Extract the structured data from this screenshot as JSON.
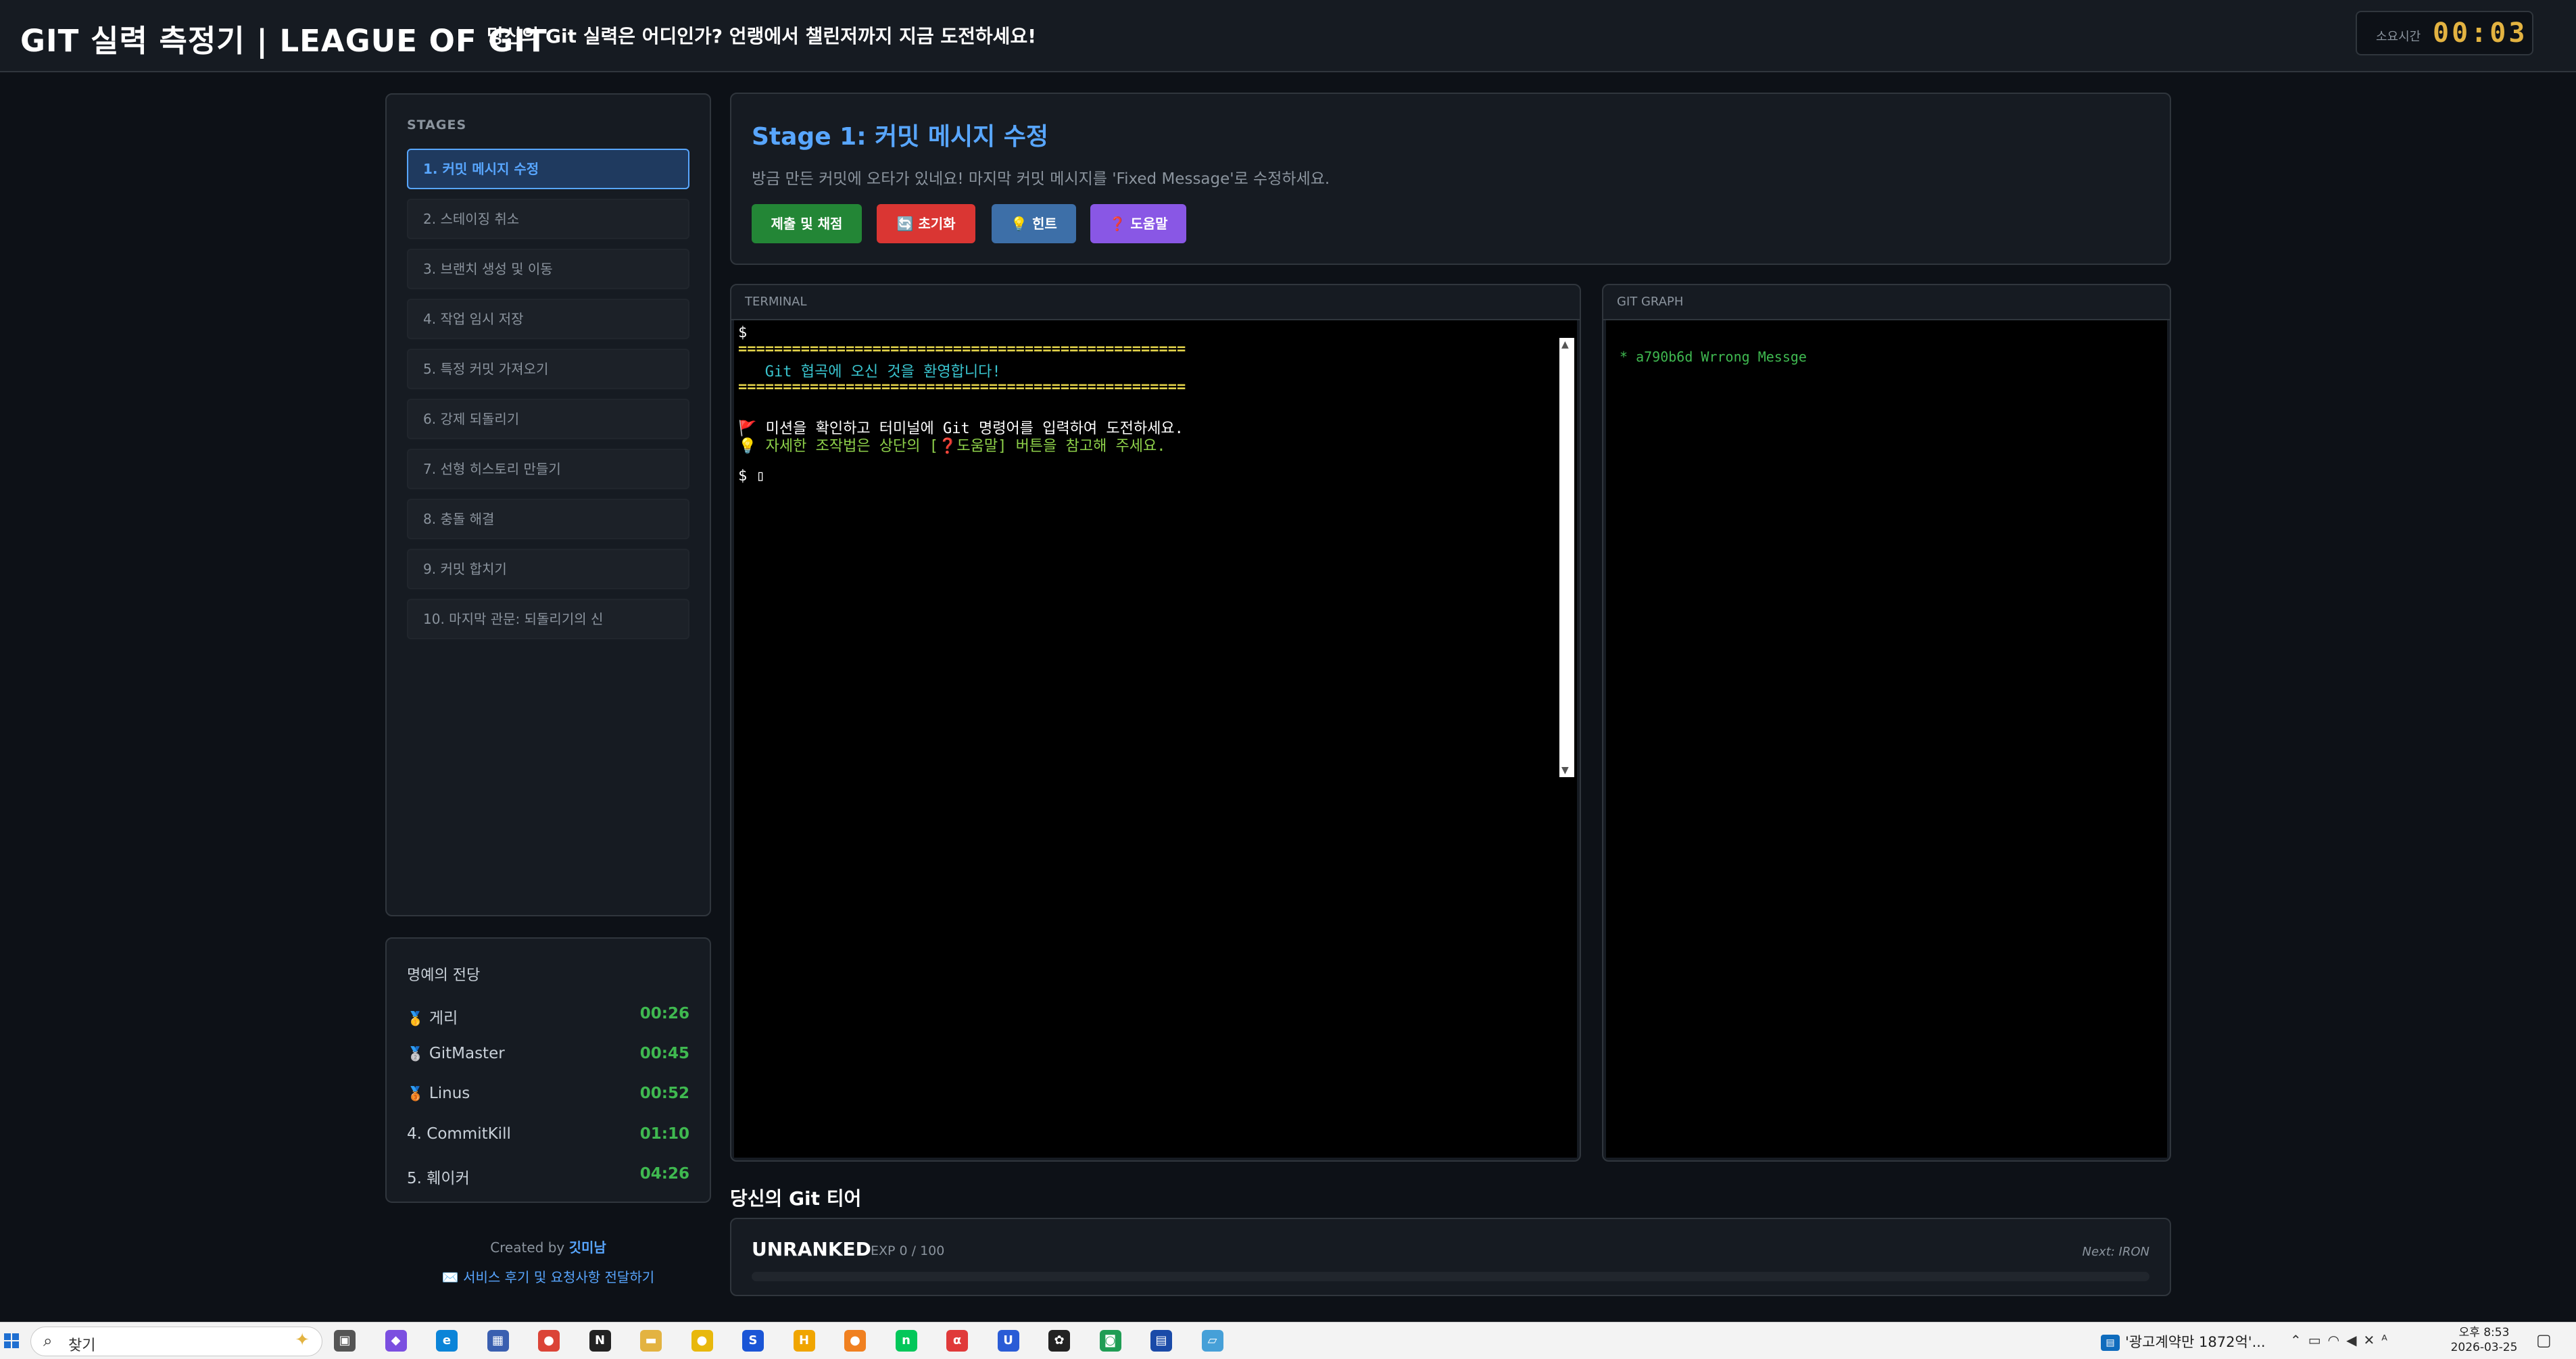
{
  "header": {
    "title": "GIT 실력 측정기 | LEAGUE OF GIT",
    "tagline": "당신의 Git 실력은 어디인가? 언랭에서 챌린저까지 지금 도전하세요!",
    "timer_label": "소요시간",
    "timer_value": "00:03"
  },
  "stages": {
    "title": "STAGES",
    "items": [
      {
        "label": "1. 커밋 메시지 수정",
        "active": true
      },
      {
        "label": "2. 스테이징 취소"
      },
      {
        "label": "3. 브랜치 생성 및 이동"
      },
      {
        "label": "4. 작업 임시 저장"
      },
      {
        "label": "5. 특정 커밋 가져오기"
      },
      {
        "label": "6. 강제 되돌리기"
      },
      {
        "label": "7. 선형 히스토리 만들기"
      },
      {
        "label": "8. 충돌 해결"
      },
      {
        "label": "9. 커밋 합치기"
      },
      {
        "label": "10. 마지막 관문: 되돌리기의 신"
      }
    ]
  },
  "hall_of_fame": {
    "title": "명예의 전당",
    "entries": [
      {
        "medal": "🥇",
        "name": "게리",
        "time": "00:26"
      },
      {
        "medal": "🥈",
        "name": "GitMaster",
        "time": "00:45"
      },
      {
        "medal": "🥉",
        "name": "Linus",
        "time": "00:52"
      },
      {
        "medal": "",
        "name": "4. CommitKill",
        "time": "01:10"
      },
      {
        "medal": "",
        "name": "5. 훼이커",
        "time": "04:26"
      }
    ]
  },
  "credit": {
    "prefix": "Created by",
    "author": "깃미남",
    "feedback": "✉️ 서비스 후기 및 요청사항 전달하기"
  },
  "mission": {
    "title": "Stage 1: 커밋 메시지 수정",
    "description": "방금 만든 커밋에 오타가 있네요! 마지막 커밋 메시지를 'Fixed Message'로 수정하세요.",
    "buttons": {
      "submit": "제출 및 채점",
      "reset": "🔄 초기화",
      "hint": "💡 힌트",
      "help": "❓ 도움말"
    },
    "colors": {
      "submit": "#238636",
      "reset": "#da3633",
      "hint": "#3d6fa8",
      "help": "#8957e5"
    }
  },
  "terminal": {
    "label": "TERMINAL",
    "lines": [
      {
        "text": "$",
        "color": "#ffffff"
      },
      {
        "text": "==================================================",
        "color": "#e3d34a"
      },
      {
        "text": "   Git 협곡에 오신 것을 환영합니다!",
        "color": "#39c5cf"
      },
      {
        "text": "==================================================",
        "color": "#e3d34a"
      },
      {
        "text": "",
        "color": "#ffffff"
      },
      {
        "text": "🚩 미션을 확인하고 터미널에 Git 명령어를 입력하여 도전하세요.",
        "color": "#ffffff"
      },
      {
        "text": "💡 자세한 조작법은 상단의 [❓도움말] 버튼을 참고해 주세요.",
        "color": "#8ed14a"
      },
      {
        "text": "",
        "color": "#ffffff"
      },
      {
        "text": "$ ▯",
        "color": "#ffffff"
      }
    ]
  },
  "git_graph": {
    "label": "GIT GRAPH",
    "line": "* a790b6d Wrrong Messge"
  },
  "tier": {
    "section_title": "당신의 Git 티어",
    "rank": "UNRANKED",
    "exp": "EXP 0 / 100",
    "next": "Next: IRON",
    "progress": 0
  },
  "taskbar": {
    "search_label": "찾기",
    "notification": "'광고계약만 1872억'...",
    "clock_time": "오후 8:53",
    "clock_date": "2026-03-25",
    "apps": [
      {
        "icon": "task-view-icon",
        "glyph": "▣",
        "color": "#555555"
      },
      {
        "icon": "copilot-icon",
        "glyph": "◆",
        "color": "#7b4fe0"
      },
      {
        "icon": "edge-icon",
        "glyph": "e",
        "color": "#0b84d8"
      },
      {
        "icon": "calculator-icon",
        "glyph": "▦",
        "color": "#3a5fb0"
      },
      {
        "icon": "chrome-icon",
        "glyph": "●",
        "color": "#db4437"
      },
      {
        "icon": "notion-icon",
        "glyph": "N",
        "color": "#222222"
      },
      {
        "icon": "file-explorer-icon",
        "glyph": "▬",
        "color": "#e3b341"
      },
      {
        "icon": "kakao-icon",
        "glyph": "●",
        "color": "#e8b80c"
      },
      {
        "icon": "sol-icon",
        "glyph": "S",
        "color": "#1a55d6"
      },
      {
        "icon": "hwp-icon",
        "glyph": "H",
        "color": "#f0a500"
      },
      {
        "icon": "app-orange-icon",
        "glyph": "●",
        "color": "#f08020"
      },
      {
        "icon": "naver-icon",
        "glyph": "n",
        "color": "#03c75a"
      },
      {
        "icon": "alpha-icon",
        "glyph": "α",
        "color": "#e03a3a"
      },
      {
        "icon": "u-app-icon",
        "glyph": "U",
        "color": "#2a5cd6"
      },
      {
        "icon": "chatgpt-icon",
        "glyph": "✿",
        "color": "#222222"
      },
      {
        "icon": "app-green-icon",
        "glyph": "◙",
        "color": "#1f9d55"
      },
      {
        "icon": "doc-app-icon",
        "glyph": "▤",
        "color": "#1a4aa8"
      },
      {
        "icon": "notepad-icon",
        "glyph": "▱",
        "color": "#46a0d8"
      }
    ]
  }
}
